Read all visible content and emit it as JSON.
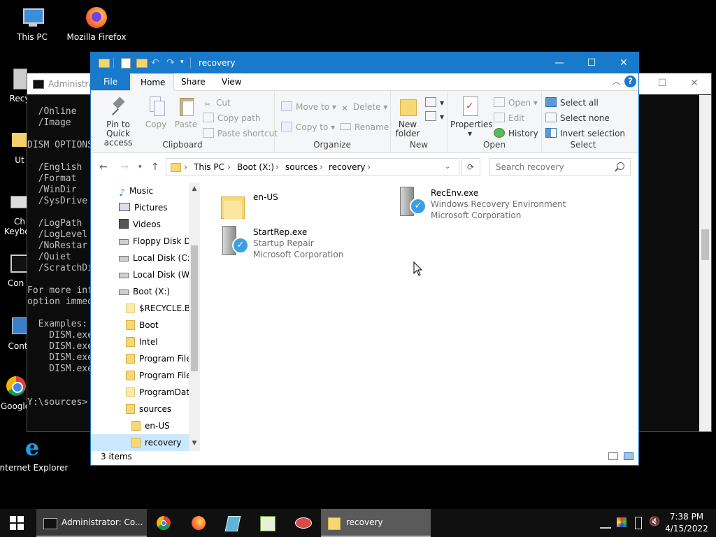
{
  "desktop": {
    "icons": [
      {
        "label": "This PC",
        "icon": "computer-icon"
      },
      {
        "label": "Mozilla Firefox",
        "icon": "firefox-icon"
      },
      {
        "label": "Recy",
        "icon": "recycle-bin-icon"
      },
      {
        "label": "Ut",
        "icon": "folder-icon"
      },
      {
        "label": "Ch Keyboa",
        "icon": "keyboard-icon"
      },
      {
        "label": "Con Pro",
        "icon": "console-icon"
      },
      {
        "label": "Contr",
        "icon": "control-panel-icon"
      },
      {
        "label": "Google",
        "icon": "chrome-icon"
      },
      {
        "label": "Internet Explorer",
        "icon": "ie-icon"
      }
    ]
  },
  "cmd": {
    "title": "Administra",
    "lines": [
      "  /Online",
      "  /Image",
      "",
      "DISM OPTIONS:",
      "",
      "  /English",
      "  /Format",
      "  /WinDir",
      "  /SysDrive",
      "",
      "  /LogPath",
      "  /LogLevel",
      "  /NoRestar",
      "  /Quiet",
      "  /ScratchDi",
      "",
      "For more inf",
      "option immed",
      "",
      "  Examples:",
      "    DISM.exe",
      "    DISM.exe",
      "    DISM.exe",
      "    DISM.exe",
      "",
      "",
      "Y:\\sources>"
    ]
  },
  "explorer": {
    "title": "recovery",
    "tabs": {
      "file": "File",
      "home": "Home",
      "share": "Share",
      "view": "View"
    },
    "ribbon": {
      "clipboard": {
        "label": "Clipboard",
        "pin": "Pin to Quick access",
        "copy": "Copy",
        "paste": "Paste",
        "cut": "Cut",
        "copy_path": "Copy path",
        "paste_shortcut": "Paste shortcut"
      },
      "organize": {
        "label": "Organize",
        "move_to": "Move to",
        "copy_to": "Copy to",
        "delete": "Delete",
        "rename": "Rename"
      },
      "new": {
        "label": "New",
        "new_folder": "New folder"
      },
      "open": {
        "label": "Open",
        "properties": "Properties",
        "open": "Open",
        "edit": "Edit",
        "history": "History"
      },
      "select": {
        "label": "Select",
        "select_all": "Select all",
        "select_none": "Select none",
        "invert": "Invert selection"
      }
    },
    "address": {
      "crumbs": [
        "This PC",
        "Boot (X:)",
        "sources",
        "recovery"
      ],
      "search_placeholder": "Search recovery"
    },
    "nav": [
      {
        "label": "Music",
        "type": "music"
      },
      {
        "label": "Pictures",
        "type": "pictures"
      },
      {
        "label": "Videos",
        "type": "videos"
      },
      {
        "label": "Floppy Disk Dri",
        "type": "floppy"
      },
      {
        "label": "Local Disk (C:)",
        "type": "drive"
      },
      {
        "label": "Local Disk (W:)",
        "type": "drive"
      },
      {
        "label": "Boot (X:)",
        "type": "drive"
      },
      {
        "label": "$RECYCLE.BIN",
        "type": "folder-pale"
      },
      {
        "label": "Boot",
        "type": "folder"
      },
      {
        "label": "Intel",
        "type": "folder"
      },
      {
        "label": "Program Files",
        "type": "folder"
      },
      {
        "label": "Program Files",
        "type": "folder"
      },
      {
        "label": "ProgramData",
        "type": "folder-pale"
      },
      {
        "label": "sources",
        "type": "folder"
      },
      {
        "label": "en-US",
        "type": "folder"
      },
      {
        "label": "recovery",
        "type": "folder"
      }
    ],
    "items": [
      {
        "name": "en-US",
        "d1": "",
        "d2": ""
      },
      {
        "name": "RecEnv.exe",
        "d1": "Windows Recovery Environment",
        "d2": "Microsoft Corporation"
      },
      {
        "name": "StartRep.exe",
        "d1": "Startup Repair",
        "d2": "Microsoft Corporation"
      }
    ],
    "status": "3 items"
  },
  "taskbar": {
    "cmd_label": "Administrator: Co...",
    "explorer_label": "recovery",
    "time": "7:38 PM",
    "date": "4/15/2022"
  }
}
